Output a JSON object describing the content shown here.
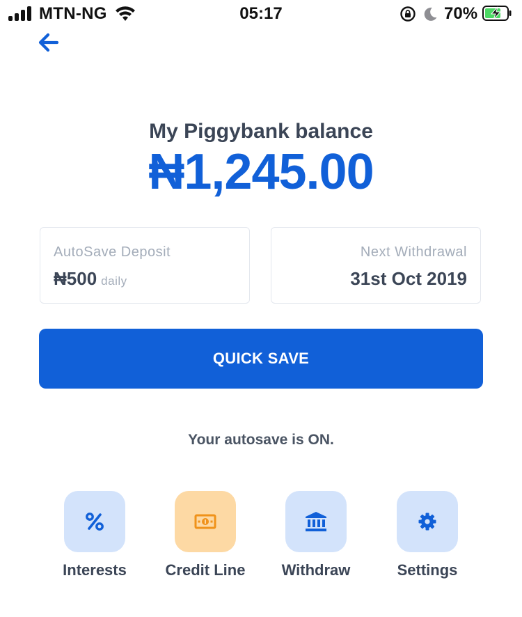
{
  "status_bar": {
    "carrier": "MTN-NG",
    "time": "05:17",
    "battery_percent": "70%",
    "icons": [
      "signal-icon",
      "wifi-icon",
      "orientation-lock-icon",
      "moon-icon",
      "battery-charging-icon"
    ]
  },
  "nav": {
    "back_icon": "arrow-left-icon"
  },
  "balance": {
    "title": "My Piggybank balance",
    "amount": "₦1,245.00"
  },
  "cards": {
    "autosave": {
      "label": "AutoSave Deposit",
      "value": "₦500",
      "unit": "daily"
    },
    "withdrawal": {
      "label": "Next Withdrawal",
      "value": "31st Oct 2019"
    }
  },
  "quick_save": {
    "label": "QUICK SAVE"
  },
  "autosave_status": "Your autosave is ON.",
  "actions": [
    {
      "label": "Interests",
      "icon": "percent-icon"
    },
    {
      "label": "Credit Line",
      "icon": "banknote-icon"
    },
    {
      "label": "Withdraw",
      "icon": "bank-icon"
    },
    {
      "label": "Settings",
      "icon": "gear-icon"
    }
  ],
  "colors": {
    "accent": "#1160d8",
    "tile_blue": "#d3e3fb",
    "tile_orange": "#fdd9a4",
    "icon_orange": "#f0921a",
    "text_dark": "#3b4556",
    "text_muted": "#a3acb9",
    "battery_green": "#4cd964"
  }
}
